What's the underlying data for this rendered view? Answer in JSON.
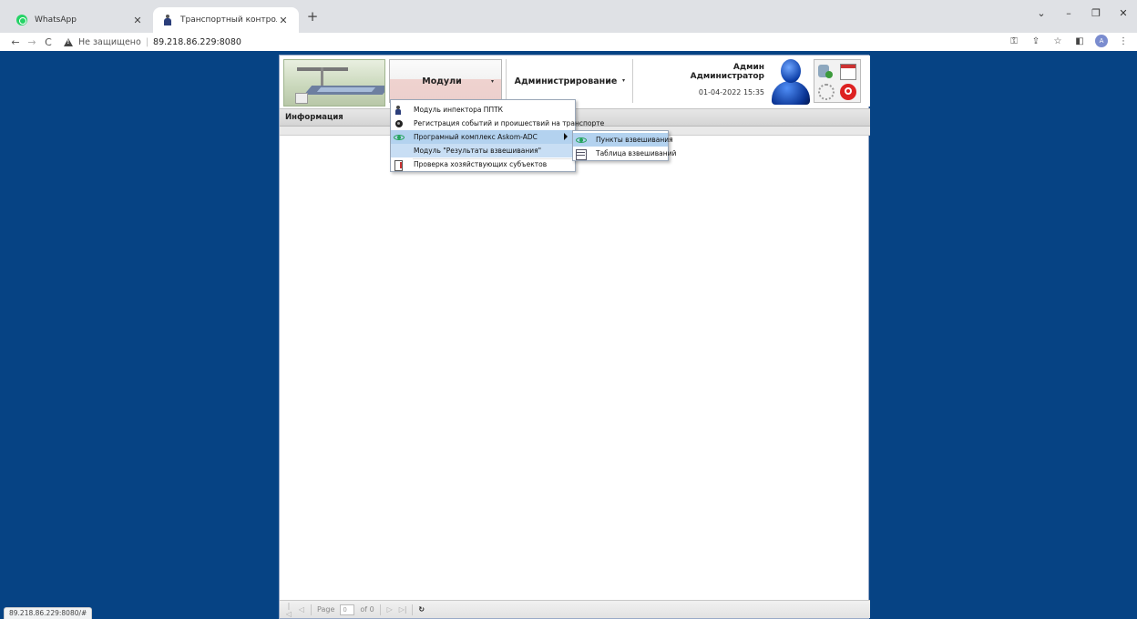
{
  "browser": {
    "tabs": [
      {
        "title": "WhatsApp",
        "close": "✕"
      },
      {
        "title": "Транспортный контроль",
        "close": "✕"
      }
    ],
    "new_tab": "+",
    "window_controls": {
      "dropdown": "⌄",
      "minimize": "–",
      "restore": "❐",
      "close": "✕"
    },
    "back": "←",
    "forward": "→",
    "reload": "C",
    "security_label": "Не защищено",
    "separator": "|",
    "url": "89.218.86.229:8080",
    "toolbar_icons": {
      "key": "⚿",
      "share": "⇪",
      "star": "☆",
      "sidebar": "◧",
      "profile": "A",
      "menu": "⋮"
    },
    "status_url": "89.218.86.229:8080/#"
  },
  "header": {
    "modules_label": "Модули",
    "admin_label": "Администрирование",
    "caret": "▾",
    "user_name": "Админ",
    "user_role": "Администратор",
    "datetime": "01-04-2022 15:35"
  },
  "info_title": "Информация",
  "main_menu": {
    "items": [
      {
        "label": "Модуль инпектора ППТК",
        "icon": "inspector-icon"
      },
      {
        "label": "Регистрация событий и проишествий на транспорте",
        "icon": "events-icon"
      },
      {
        "label": "Програмный комплекс Askom-ADC",
        "icon": "eye-icon"
      },
      {
        "label": "Модуль \"Результаты взвешивания\"",
        "icon": ""
      },
      {
        "label": "Проверка хозяйствующих субъектов",
        "icon": "check-icon"
      }
    ]
  },
  "sub_menu": {
    "items": [
      {
        "label": "Пункты взвешивания",
        "icon": "eye-icon"
      },
      {
        "label": "Таблица взвешиваний",
        "icon": "table-icon"
      }
    ]
  },
  "pager": {
    "first": "|◁",
    "prev": "◁",
    "page_label": "Page",
    "page_value": "0",
    "of_label": "of 0",
    "next": "▷",
    "last": "▷|",
    "refresh": "↻"
  },
  "colors": {
    "page_background": "#064384",
    "menu_highlight": "#b3d2ef"
  }
}
